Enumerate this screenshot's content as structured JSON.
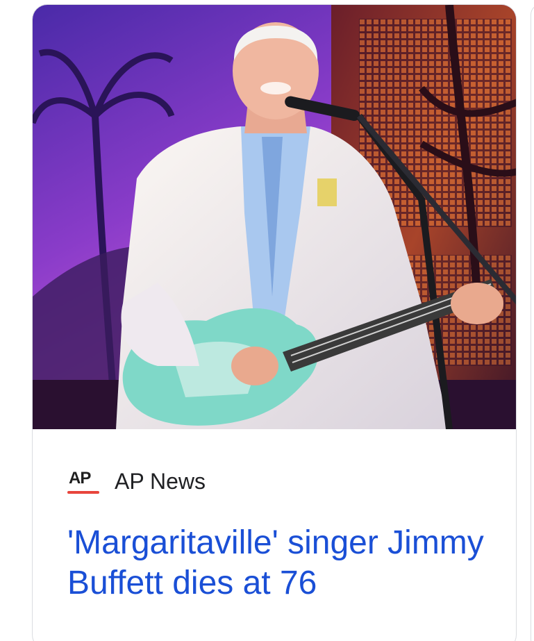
{
  "card": {
    "image_alt": "Jimmy Buffett performing on stage with a guitar",
    "source": {
      "logo_text": "AP",
      "name": "AP News"
    },
    "headline": "'Margaritaville' singer Jimmy Buffett dies at 76"
  },
  "colors": {
    "headline_link": "#1a4fd6",
    "source_text": "#202124",
    "logo_underline": "#e8453c",
    "card_border": "#dadce0"
  }
}
